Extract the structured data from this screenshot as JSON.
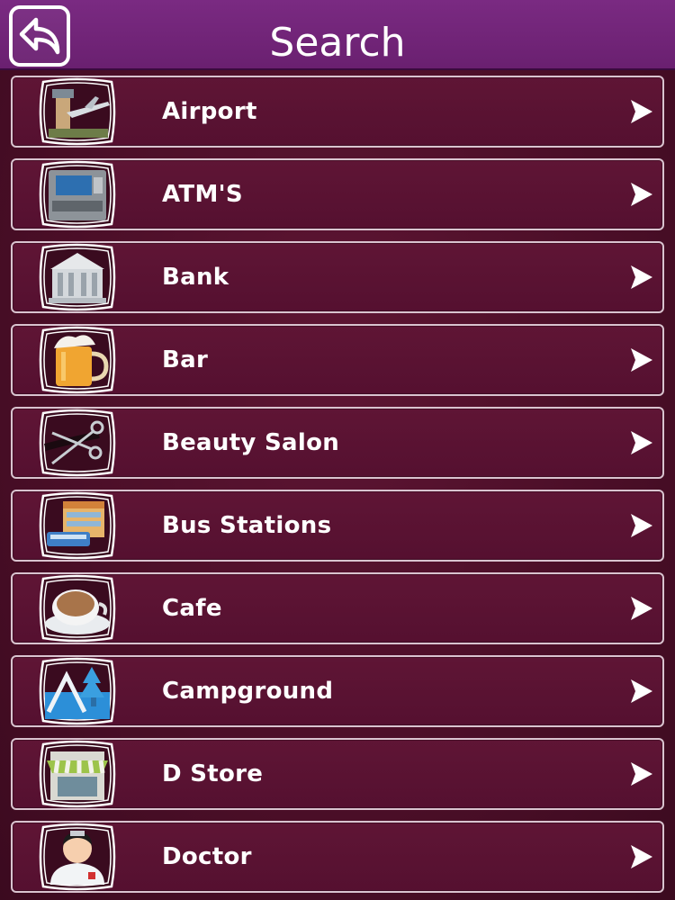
{
  "header": {
    "title": "Search",
    "back_icon": "back-arrow-icon",
    "background_color": "#6f2477"
  },
  "categories": [
    {
      "label": "Airport",
      "icon": "airport-icon"
    },
    {
      "label": "ATM'S",
      "icon": "atm-icon"
    },
    {
      "label": "Bank",
      "icon": "bank-icon"
    },
    {
      "label": "Bar",
      "icon": "beer-mug-icon"
    },
    {
      "label": "Beauty Salon",
      "icon": "scissors-icon"
    },
    {
      "label": "Bus Stations",
      "icon": "bus-station-icon"
    },
    {
      "label": "Cafe",
      "icon": "coffee-cup-icon"
    },
    {
      "label": "Campground",
      "icon": "tent-icon"
    },
    {
      "label": "D Store",
      "icon": "store-icon"
    },
    {
      "label": "Doctor",
      "icon": "doctor-icon"
    }
  ],
  "theme": {
    "row_background": "#5a1232",
    "row_border": "#d9c3cf",
    "text_color": "#ffffff"
  }
}
